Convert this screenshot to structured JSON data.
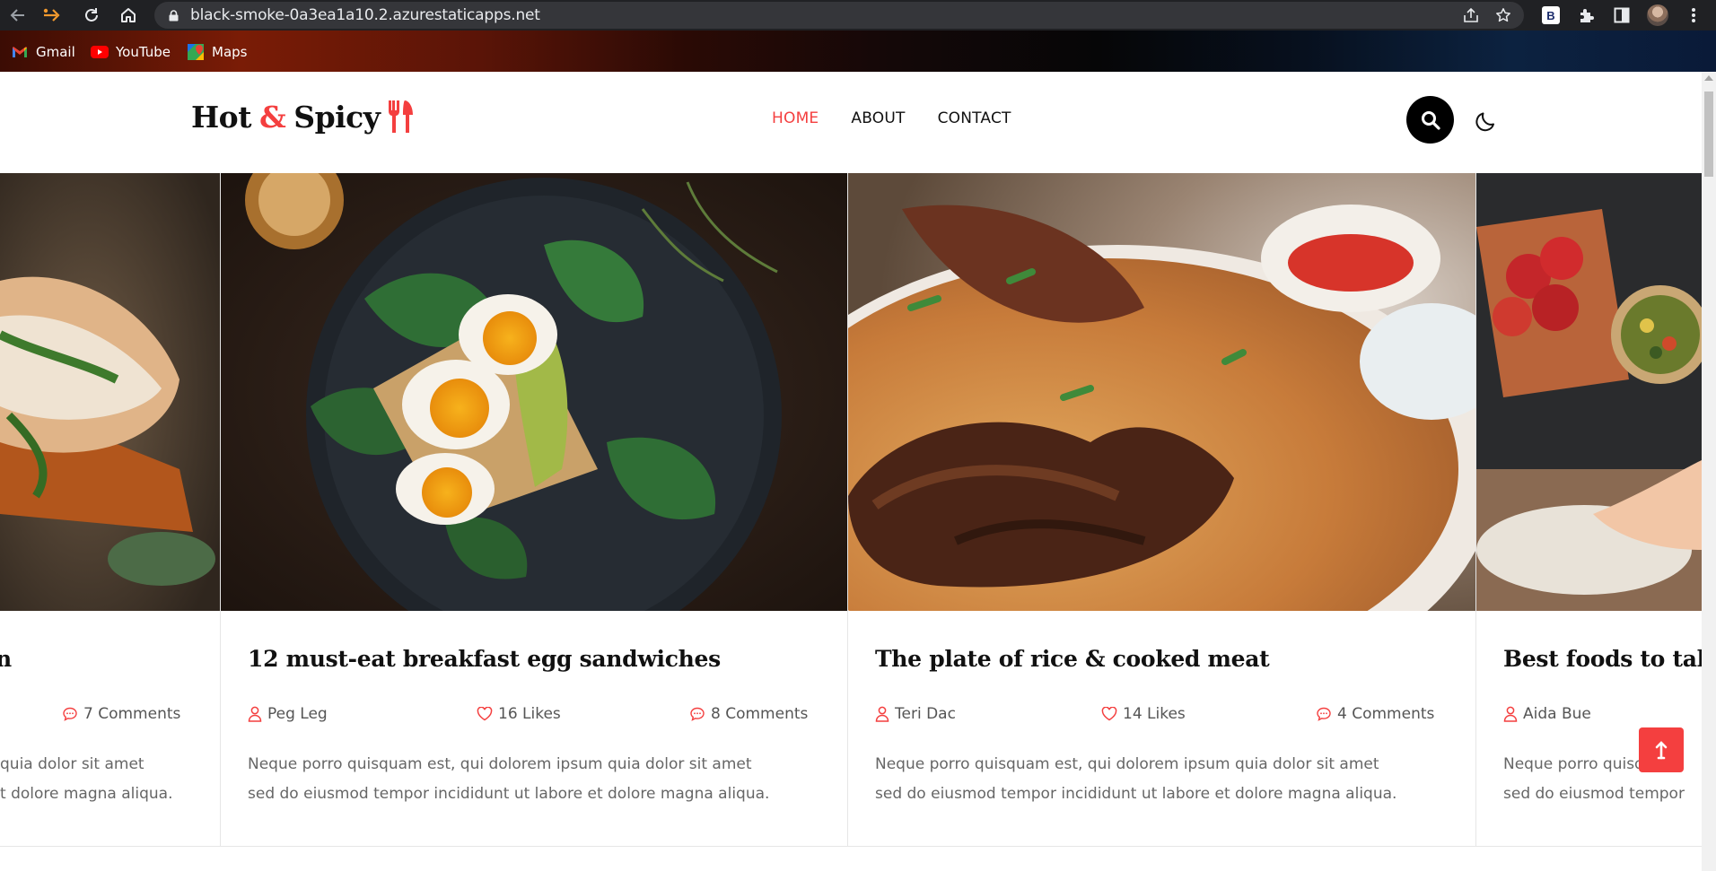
{
  "browser": {
    "url": "black-smoke-0a3ea1a10.2.azurestaticapps.net",
    "bookmarks": [
      {
        "label": "Gmail",
        "icon": "gmail-icon"
      },
      {
        "label": "YouTube",
        "icon": "youtube-icon"
      },
      {
        "label": "Maps",
        "icon": "maps-icon"
      }
    ],
    "extension_badge": "B"
  },
  "site": {
    "logo": {
      "part1": "Hot",
      "amp": "&",
      "part2": "Spicy"
    },
    "nav": [
      {
        "label": "HOME",
        "active": true
      },
      {
        "label": "ABOUT",
        "active": false
      },
      {
        "label": "CONTACT",
        "active": false
      }
    ],
    "accent_color": "#f43f3f"
  },
  "cards": [
    {
      "title_fragment": "n",
      "comments": "7 Comments",
      "excerpt_line1": "quia dolor sit amet",
      "excerpt_line2": "t dolore magna aliqua."
    },
    {
      "title": "12 must-eat breakfast egg sandwiches",
      "author": "Peg Leg",
      "likes": "16 Likes",
      "comments": "8 Comments",
      "excerpt_line1": "Neque porro quisquam est, qui dolorem ipsum quia dolor sit amet",
      "excerpt_line2": "sed do eiusmod tempor incididunt ut labore et dolore magna aliqua."
    },
    {
      "title": "The plate of rice & cooked meat",
      "author": "Teri Dac",
      "likes": "14 Likes",
      "comments": "4 Comments",
      "excerpt_line1": "Neque porro quisquam est, qui dolorem ipsum quia dolor sit amet",
      "excerpt_line2": "sed do eiusmod tempor incididunt ut labore et dolore magna aliqua."
    },
    {
      "title": "Best foods to take",
      "author": "Aida Bue",
      "excerpt_line1": "Neque porro quisquam",
      "excerpt_line2": "sed do eiusmod tempor"
    }
  ]
}
